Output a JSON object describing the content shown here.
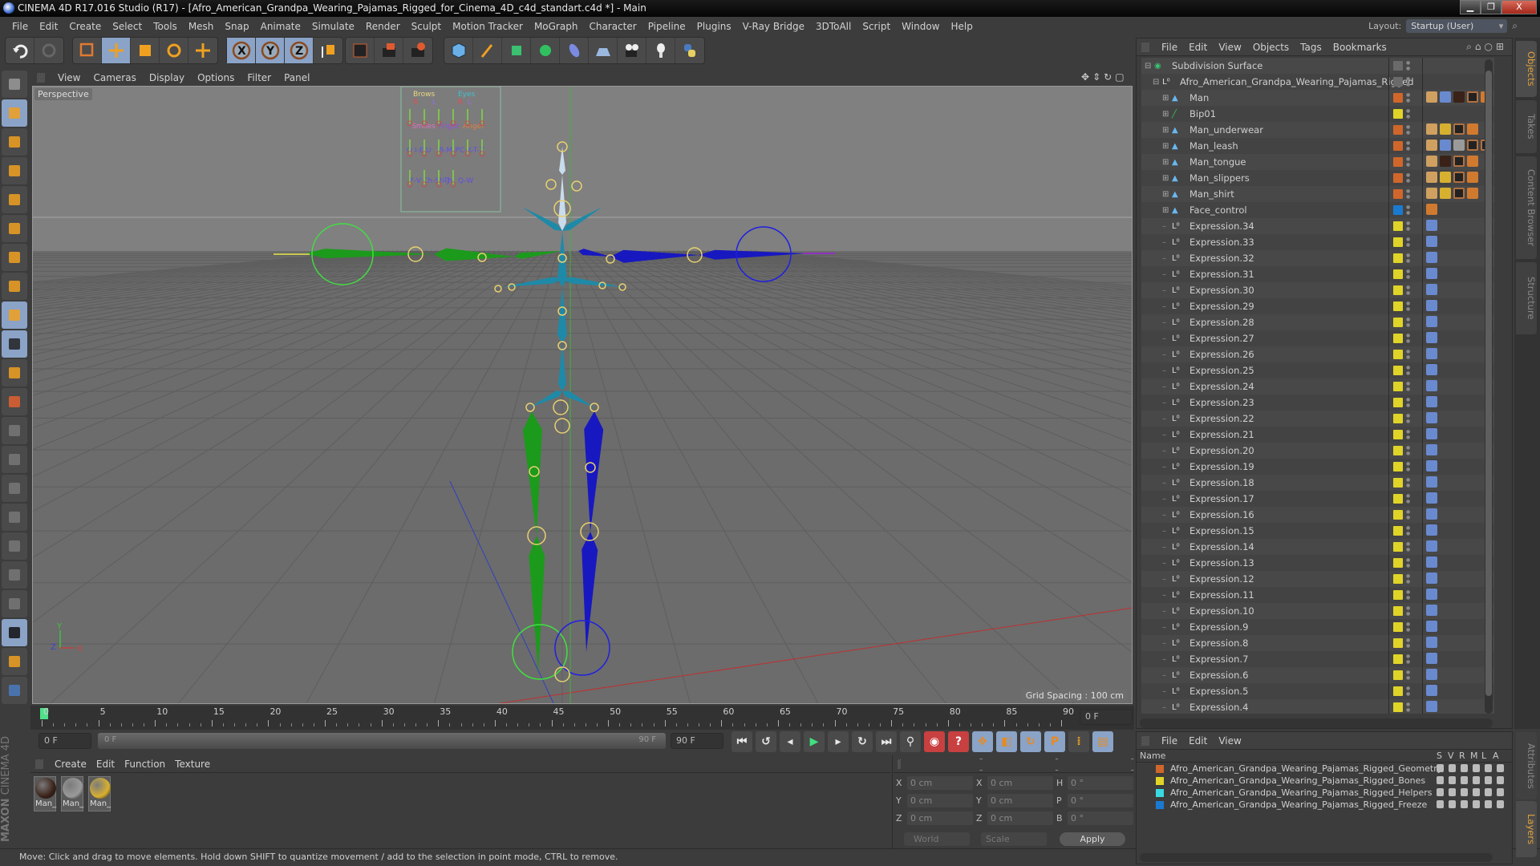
{
  "window": {
    "title": "CINEMA 4D R17.016 Studio (R17) - [Afro_American_Grandpa_Wearing_Pajamas_Rigged_for_Cinema_4D_c4d_standart.c4d *] - Main",
    "controls": [
      "minimize",
      "restore",
      "close"
    ]
  },
  "menubar": {
    "items": [
      "File",
      "Edit",
      "Create",
      "Select",
      "Tools",
      "Mesh",
      "Snap",
      "Animate",
      "Simulate",
      "Render",
      "Sculpt",
      "Motion Tracker",
      "MoGraph",
      "Character",
      "Pipeline",
      "Plugins",
      "V-Ray Bridge",
      "3DToAll",
      "Script",
      "Window",
      "Help"
    ],
    "layout_label": "Layout:",
    "layout_value": "Startup (User)"
  },
  "toolbar": {
    "groups": [
      {
        "name": "history",
        "icons": [
          "undo-icon",
          "redo-icon"
        ]
      },
      {
        "name": "tools",
        "icons": [
          "live-selection-icon",
          "move-icon",
          "scale-icon",
          "rotate-icon",
          "last-tool-icon"
        ]
      },
      {
        "name": "axes",
        "icons": [
          "x-axis-icon",
          "y-axis-icon",
          "z-axis-icon",
          "coordinate-system-icon"
        ]
      },
      {
        "name": "render",
        "icons": [
          "render-view-icon",
          "render-picture-viewer-icon",
          "render-settings-icon"
        ]
      },
      {
        "name": "objects",
        "icons": [
          "cube-icon",
          "pen-icon",
          "subdivision-icon",
          "mograph-cloner-icon",
          "deformer-icon",
          "floor-icon",
          "camera-icon",
          "light-icon",
          "python-icon"
        ]
      }
    ]
  },
  "left_tools": [
    "make-editable-icon",
    "model-mode-icon",
    "texture-mode-icon",
    "workplane-mode-icon",
    "points-mode-icon",
    "edges-mode-icon",
    "polygons-mode-icon",
    "axis-mode-icon",
    "tweak-mode-icon",
    "solo-icon",
    "snap-icon",
    "workplane-icon",
    "add-joint-icon",
    "pose-icon",
    "rotation-icon",
    "psr-icon",
    "target-icon",
    "weight-icon",
    "bind-icon",
    "lock-workplane-icon",
    "align-workplane-icon",
    "python-icon"
  ],
  "viewport": {
    "menu": [
      "View",
      "Cameras",
      "Display",
      "Options",
      "Filter",
      "Panel"
    ],
    "camera_label": "Perspective",
    "grid_spacing": "Grid Spacing : 100 cm",
    "face_control_labels": {
      "row1": [
        "Brows",
        "Eyes"
      ],
      "row1_sub": [
        "R",
        "L",
        "R",
        "L"
      ],
      "row2": [
        "Smiles",
        "Fright",
        "Anger"
      ],
      "row3": [
        "O",
        "I-E",
        "U",
        "B-M-P",
        "C-K-T-Z"
      ],
      "row4": [
        "F-V",
        "Ch-Sh-J",
        "Th",
        "Q-W"
      ]
    },
    "axis_labels": [
      "Y",
      "Z",
      "X"
    ]
  },
  "timeline": {
    "ticks": [
      0,
      5,
      10,
      15,
      20,
      25,
      30,
      35,
      40,
      45,
      50,
      55,
      60,
      65,
      70,
      75,
      80,
      85,
      90
    ],
    "current_frame": "0 F",
    "start_field": "0 F",
    "range_start": "0 F",
    "range_end": "90 F",
    "end_field": "90 F",
    "transport": [
      "go-start-icon",
      "prev-key-icon",
      "prev-frame-icon",
      "play-icon",
      "next-frame-icon",
      "next-key-icon",
      "go-end-icon"
    ],
    "record": [
      "keyframe-selection-icon",
      "autokey-icon",
      "keyframe-help-icon"
    ],
    "key_modes": [
      "key-position-icon",
      "key-scale-icon",
      "key-rotation-icon",
      "key-param-icon",
      "key-pla-icon"
    ],
    "timeline_button": "timeline-icon",
    "playhead_fraction": 0.0
  },
  "materials": {
    "menu": [
      "Create",
      "Edit",
      "Function",
      "Texture"
    ],
    "items": [
      {
        "label": "Man_",
        "swatch": "#3a2218"
      },
      {
        "label": "Man_",
        "swatch": "#9a9a9a"
      },
      {
        "label": "Man_",
        "swatch": "#d8b030"
      }
    ]
  },
  "coordinates": {
    "headers": [
      "--",
      "--",
      "--"
    ],
    "rows": [
      {
        "a": "X",
        "av": "0 cm",
        "b": "X",
        "bv": "0 cm",
        "c": "H",
        "cv": "0 °"
      },
      {
        "a": "Y",
        "av": "0 cm",
        "b": "Y",
        "bv": "0 cm",
        "c": "P",
        "cv": "0 °"
      },
      {
        "a": "Z",
        "av": "0 cm",
        "b": "Z",
        "bv": "0 cm",
        "c": "B",
        "cv": "0 °"
      }
    ],
    "space": "World",
    "mode": "Scale",
    "apply": "Apply"
  },
  "object_manager": {
    "menu": [
      "File",
      "Edit",
      "View",
      "Objects",
      "Tags",
      "Bookmarks"
    ],
    "objects": [
      {
        "name": "Subdivision Surface",
        "indent": 0,
        "icon": "subdivision-icon",
        "color": "#6a6a6a",
        "tags": []
      },
      {
        "name": "Afro_American_Grandpa_Wearing_Pajamas_Rigged",
        "indent": 1,
        "icon": "null-icon",
        "color": "#6a6a6a",
        "tags": []
      },
      {
        "name": "Man",
        "indent": 2,
        "icon": "polygon-icon",
        "color": "#d0662a",
        "tags": [
          "uvw",
          "skin",
          "mat-dark",
          "texture",
          "selection"
        ]
      },
      {
        "name": "Bip01",
        "indent": 2,
        "icon": "joint-icon",
        "color": "#e0d428",
        "tags": []
      },
      {
        "name": "Man_underwear",
        "indent": 2,
        "icon": "polygon-icon",
        "color": "#d0662a",
        "tags": [
          "uvw",
          "mat-yellow",
          "texture",
          "selection"
        ]
      },
      {
        "name": "Man_leash",
        "indent": 2,
        "icon": "polygon-icon",
        "color": "#d0662a",
        "tags": [
          "uvw",
          "skin",
          "mat-grey",
          "texture",
          "texture",
          "texture"
        ]
      },
      {
        "name": "Man_tongue",
        "indent": 2,
        "icon": "polygon-icon",
        "color": "#d0662a",
        "tags": [
          "uvw",
          "mat-dark",
          "texture",
          "selection"
        ]
      },
      {
        "name": "Man_slippers",
        "indent": 2,
        "icon": "polygon-icon",
        "color": "#d0662a",
        "tags": [
          "uvw",
          "mat-yellow",
          "texture",
          "selection"
        ]
      },
      {
        "name": "Man_shirt",
        "indent": 2,
        "icon": "polygon-icon",
        "color": "#d0662a",
        "tags": [
          "uvw",
          "mat-yellow",
          "texture",
          "selection"
        ]
      },
      {
        "name": "Face_control",
        "indent": 2,
        "icon": "polygon-icon",
        "color": "#1a7ad0",
        "tags": [
          "selection"
        ]
      },
      {
        "name": "Expression.34",
        "indent": 2,
        "icon": "null-icon",
        "color": "#e0d428",
        "tags": [
          "xpresso"
        ]
      },
      {
        "name": "Expression.33",
        "indent": 2,
        "icon": "null-icon",
        "color": "#e0d428",
        "tags": [
          "xpresso"
        ]
      },
      {
        "name": "Expression.32",
        "indent": 2,
        "icon": "null-icon",
        "color": "#e0d428",
        "tags": [
          "xpresso"
        ]
      },
      {
        "name": "Expression.31",
        "indent": 2,
        "icon": "null-icon",
        "color": "#e0d428",
        "tags": [
          "xpresso"
        ]
      },
      {
        "name": "Expression.30",
        "indent": 2,
        "icon": "null-icon",
        "color": "#e0d428",
        "tags": [
          "xpresso"
        ]
      },
      {
        "name": "Expression.29",
        "indent": 2,
        "icon": "null-icon",
        "color": "#e0d428",
        "tags": [
          "xpresso"
        ]
      },
      {
        "name": "Expression.28",
        "indent": 2,
        "icon": "null-icon",
        "color": "#e0d428",
        "tags": [
          "xpresso"
        ]
      },
      {
        "name": "Expression.27",
        "indent": 2,
        "icon": "null-icon",
        "color": "#e0d428",
        "tags": [
          "xpresso"
        ]
      },
      {
        "name": "Expression.26",
        "indent": 2,
        "icon": "null-icon",
        "color": "#e0d428",
        "tags": [
          "xpresso"
        ]
      },
      {
        "name": "Expression.25",
        "indent": 2,
        "icon": "null-icon",
        "color": "#e0d428",
        "tags": [
          "xpresso"
        ]
      },
      {
        "name": "Expression.24",
        "indent": 2,
        "icon": "null-icon",
        "color": "#e0d428",
        "tags": [
          "xpresso"
        ]
      },
      {
        "name": "Expression.23",
        "indent": 2,
        "icon": "null-icon",
        "color": "#e0d428",
        "tags": [
          "xpresso"
        ]
      },
      {
        "name": "Expression.22",
        "indent": 2,
        "icon": "null-icon",
        "color": "#e0d428",
        "tags": [
          "xpresso"
        ]
      },
      {
        "name": "Expression.21",
        "indent": 2,
        "icon": "null-icon",
        "color": "#e0d428",
        "tags": [
          "xpresso"
        ]
      },
      {
        "name": "Expression.20",
        "indent": 2,
        "icon": "null-icon",
        "color": "#e0d428",
        "tags": [
          "xpresso"
        ]
      },
      {
        "name": "Expression.19",
        "indent": 2,
        "icon": "null-icon",
        "color": "#e0d428",
        "tags": [
          "xpresso"
        ]
      },
      {
        "name": "Expression.18",
        "indent": 2,
        "icon": "null-icon",
        "color": "#e0d428",
        "tags": [
          "xpresso"
        ]
      },
      {
        "name": "Expression.17",
        "indent": 2,
        "icon": "null-icon",
        "color": "#e0d428",
        "tags": [
          "xpresso"
        ]
      },
      {
        "name": "Expression.16",
        "indent": 2,
        "icon": "null-icon",
        "color": "#e0d428",
        "tags": [
          "xpresso"
        ]
      },
      {
        "name": "Expression.15",
        "indent": 2,
        "icon": "null-icon",
        "color": "#e0d428",
        "tags": [
          "xpresso"
        ]
      },
      {
        "name": "Expression.14",
        "indent": 2,
        "icon": "null-icon",
        "color": "#e0d428",
        "tags": [
          "xpresso"
        ]
      },
      {
        "name": "Expression.13",
        "indent": 2,
        "icon": "null-icon",
        "color": "#e0d428",
        "tags": [
          "xpresso"
        ]
      },
      {
        "name": "Expression.12",
        "indent": 2,
        "icon": "null-icon",
        "color": "#e0d428",
        "tags": [
          "xpresso"
        ]
      },
      {
        "name": "Expression.11",
        "indent": 2,
        "icon": "null-icon",
        "color": "#e0d428",
        "tags": [
          "xpresso"
        ]
      },
      {
        "name": "Expression.10",
        "indent": 2,
        "icon": "null-icon",
        "color": "#e0d428",
        "tags": [
          "xpresso"
        ]
      },
      {
        "name": "Expression.9",
        "indent": 2,
        "icon": "null-icon",
        "color": "#e0d428",
        "tags": [
          "xpresso"
        ]
      },
      {
        "name": "Expression.8",
        "indent": 2,
        "icon": "null-icon",
        "color": "#e0d428",
        "tags": [
          "xpresso"
        ]
      },
      {
        "name": "Expression.7",
        "indent": 2,
        "icon": "null-icon",
        "color": "#e0d428",
        "tags": [
          "xpresso"
        ]
      },
      {
        "name": "Expression.6",
        "indent": 2,
        "icon": "null-icon",
        "color": "#e0d428",
        "tags": [
          "xpresso"
        ]
      },
      {
        "name": "Expression.5",
        "indent": 2,
        "icon": "null-icon",
        "color": "#e0d428",
        "tags": [
          "xpresso"
        ]
      },
      {
        "name": "Expression.4",
        "indent": 2,
        "icon": "null-icon",
        "color": "#e0d428",
        "tags": [
          "xpresso"
        ]
      }
    ]
  },
  "side_tabs_top": [
    {
      "label": "Objects",
      "active": true
    },
    {
      "label": "Takes",
      "active": false
    },
    {
      "label": "Content Browser",
      "active": false
    },
    {
      "label": "Structure",
      "active": false
    }
  ],
  "side_tabs_bottom": [
    {
      "label": "Attributes",
      "active": false
    },
    {
      "label": "Layers",
      "active": true
    }
  ],
  "layers": {
    "menu": [
      "File",
      "Edit",
      "View"
    ],
    "columns": [
      "Name",
      "S",
      "V",
      "R",
      "M",
      "L",
      "A"
    ],
    "items": [
      {
        "name": "Afro_American_Grandpa_Wearing_Pajamas_Rigged_Geometry",
        "color": "#d0662a"
      },
      {
        "name": "Afro_American_Grandpa_Wearing_Pajamas_Rigged_Bones",
        "color": "#e0d428"
      },
      {
        "name": "Afro_American_Grandpa_Wearing_Pajamas_Rigged_Helpers",
        "color": "#3ad8e0"
      },
      {
        "name": "Afro_American_Grandpa_Wearing_Pajamas_Rigged_Freeze",
        "color": "#1a7ad0"
      }
    ]
  },
  "status": {
    "text": "Move: Click and drag to move elements. Hold down SHIFT to quantize movement / add to the selection in point mode, CTRL to remove."
  },
  "branding": {
    "line1": "MAXON",
    "line2": "CINEMA 4D"
  }
}
